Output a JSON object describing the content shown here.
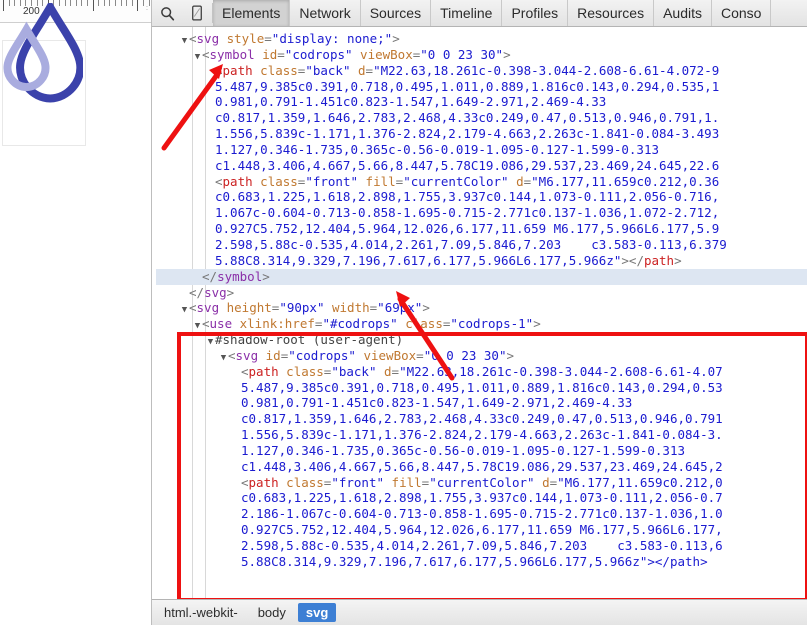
{
  "page_pane": {
    "ruler": {
      "label": "200",
      "name": "horizontal-ruler"
    },
    "logo": {
      "name": "codrops-water-droplet-logo",
      "back_color": "#a9acdf",
      "front_color": "#3b42ab"
    }
  },
  "devtools": {
    "toolbar": {
      "search_icon": "search-icon",
      "device_icon": "device-toggle-icon",
      "tabs": [
        {
          "label": "Elements",
          "selected": true
        },
        {
          "label": "Network",
          "selected": false
        },
        {
          "label": "Sources",
          "selected": false
        },
        {
          "label": "Timeline",
          "selected": false
        },
        {
          "label": "Profiles",
          "selected": false
        },
        {
          "label": "Resources",
          "selected": false
        },
        {
          "label": "Audits",
          "selected": false
        },
        {
          "label": "Conso",
          "selected": false
        }
      ]
    },
    "code_lines": [
      {
        "indent": 0,
        "twisty": "down",
        "segments": [
          {
            "t": "punc",
            "v": "<"
          },
          {
            "t": "tagp",
            "v": "svg"
          },
          {
            "t": "attr",
            "v": " style"
          },
          {
            "t": "punc",
            "v": "="
          },
          {
            "t": "val",
            "v": "\"display: none;\""
          },
          {
            "t": "punc",
            "v": ">"
          }
        ]
      },
      {
        "indent": 1,
        "twisty": "down",
        "segments": [
          {
            "t": "punc",
            "v": "<"
          },
          {
            "t": "tagp",
            "v": "symbol"
          },
          {
            "t": "attr",
            "v": " id"
          },
          {
            "t": "punc",
            "v": "="
          },
          {
            "t": "val",
            "v": "\"codrops\""
          },
          {
            "t": "attr",
            "v": " viewBox"
          },
          {
            "t": "punc",
            "v": "="
          },
          {
            "t": "val",
            "v": "\"0 0 23 30\""
          },
          {
            "t": "punc",
            "v": ">"
          }
        ]
      },
      {
        "indent": 2,
        "twisty": "none",
        "segments": [
          {
            "t": "punc",
            "v": "<"
          },
          {
            "t": "tagr",
            "v": "path"
          },
          {
            "t": "attr",
            "v": " class"
          },
          {
            "t": "punc",
            "v": "="
          },
          {
            "t": "val",
            "v": "\"back\""
          },
          {
            "t": "attr",
            "v": " d"
          },
          {
            "t": "punc",
            "v": "="
          },
          {
            "t": "val",
            "v": "\"M22.63,18.261c-0.398-3.044-2.608-6.61-4.072-9"
          }
        ]
      },
      {
        "indent": 2,
        "twisty": "none",
        "segments": [
          {
            "t": "val",
            "v": "5.487,9.385c0.391,0.718,0.495,1.011,0.889,1.816c0.143,0.294,0.535,1"
          }
        ]
      },
      {
        "indent": 2,
        "twisty": "none",
        "segments": [
          {
            "t": "val",
            "v": "0.981,0.791-1.451c0.823-1.547,1.649-2.971,2.469-4.33"
          }
        ]
      },
      {
        "indent": 2,
        "twisty": "none",
        "segments": [
          {
            "t": "val",
            "v": "c0.817,1.359,1.646,2.783,2.468,4.33c0.249,0.47,0.513,0.946,0.791,1."
          }
        ]
      },
      {
        "indent": 2,
        "twisty": "none",
        "segments": [
          {
            "t": "val",
            "v": "1.556,5.839c-1.171,1.376-2.824,2.179-4.663,2.263c-1.841-0.084-3.493"
          }
        ]
      },
      {
        "indent": 2,
        "twisty": "none",
        "segments": [
          {
            "t": "val",
            "v": "1.127,0.346-1.735,0.365c-0.56-0.019-1.095-0.127-1.599-0.313"
          }
        ]
      },
      {
        "indent": 2,
        "twisty": "none",
        "segments": [
          {
            "t": "val",
            "v": "c1.448,3.406,4.667,5.66,8.447,5.78C19.086,29.537,23.469,24.645,22.6"
          }
        ]
      },
      {
        "indent": 2,
        "twisty": "none",
        "segments": [
          {
            "t": "punc",
            "v": "<"
          },
          {
            "t": "tagr",
            "v": "path"
          },
          {
            "t": "attr",
            "v": " class"
          },
          {
            "t": "punc",
            "v": "="
          },
          {
            "t": "val",
            "v": "\"front\""
          },
          {
            "t": "attr",
            "v": " fill"
          },
          {
            "t": "punc",
            "v": "="
          },
          {
            "t": "val",
            "v": "\"currentColor\""
          },
          {
            "t": "attr",
            "v": " d"
          },
          {
            "t": "punc",
            "v": "="
          },
          {
            "t": "val",
            "v": "\"M6.177,11.659c0.212,0.36"
          }
        ]
      },
      {
        "indent": 2,
        "twisty": "none",
        "segments": [
          {
            "t": "val",
            "v": "c0.683,1.225,1.618,2.898,1.755,3.937c0.144,1.073-0.111,2.056-0.716,"
          }
        ]
      },
      {
        "indent": 2,
        "twisty": "none",
        "segments": [
          {
            "t": "val",
            "v": "1.067c-0.604-0.713-0.858-1.695-0.715-2.771c0.137-1.036,1.072-2.712,"
          }
        ]
      },
      {
        "indent": 2,
        "twisty": "none",
        "segments": [
          {
            "t": "val",
            "v": "0.927C5.752,12.404,5.964,12.026,6.177,11.659 M6.177,5.966L6.177,5.9"
          }
        ]
      },
      {
        "indent": 2,
        "twisty": "none",
        "segments": [
          {
            "t": "val",
            "v": "2.598,5.88c-0.535,4.014,2.261,7.09,5.846,7.203    c3.583-0.113,6.379"
          }
        ]
      },
      {
        "indent": 2,
        "twisty": "none",
        "segments": [
          {
            "t": "val",
            "v": "5.88C8.314,9.329,7.196,7.617,6.177,5.966L6.177,5.966z\""
          },
          {
            "t": "punc",
            "v": ">"
          },
          {
            "t": "punc",
            "v": "</"
          },
          {
            "t": "tagr",
            "v": "path"
          },
          {
            "t": "punc",
            "v": ">"
          }
        ]
      },
      {
        "indent": 1,
        "twisty": "none",
        "highlight": true,
        "segments": [
          {
            "t": "punc",
            "v": "</"
          },
          {
            "t": "tagp",
            "v": "symbol"
          },
          {
            "t": "punc",
            "v": ">"
          }
        ]
      },
      {
        "indent": 0,
        "twisty": "none",
        "segments": [
          {
            "t": "punc",
            "v": "</"
          },
          {
            "t": "tagp",
            "v": "svg"
          },
          {
            "t": "punc",
            "v": ">"
          }
        ]
      },
      {
        "indent": 0,
        "twisty": "down",
        "segments": [
          {
            "t": "punc",
            "v": "<"
          },
          {
            "t": "tagp",
            "v": "svg"
          },
          {
            "t": "attr",
            "v": " height"
          },
          {
            "t": "punc",
            "v": "="
          },
          {
            "t": "val",
            "v": "\"90px\""
          },
          {
            "t": "attr",
            "v": " width"
          },
          {
            "t": "punc",
            "v": "="
          },
          {
            "t": "val",
            "v": "\"69px\""
          },
          {
            "t": "punc",
            "v": ">"
          }
        ]
      },
      {
        "indent": 1,
        "twisty": "down",
        "segments": [
          {
            "t": "punc",
            "v": "<"
          },
          {
            "t": "tagp",
            "v": "use"
          },
          {
            "t": "attr",
            "v": " xlink:href"
          },
          {
            "t": "punc",
            "v": "="
          },
          {
            "t": "val",
            "v": "\"#codrops\""
          },
          {
            "t": "attr",
            "v": " class"
          },
          {
            "t": "punc",
            "v": "="
          },
          {
            "t": "val",
            "v": "\"codrops-1\""
          },
          {
            "t": "punc",
            "v": ">"
          }
        ]
      },
      {
        "indent": 2,
        "twisty": "down",
        "segments": [
          {
            "t": "shadow",
            "v": "#shadow-root (user-agent)"
          }
        ]
      },
      {
        "indent": 3,
        "twisty": "down",
        "segments": [
          {
            "t": "punc",
            "v": "<"
          },
          {
            "t": "tagp",
            "v": "svg"
          },
          {
            "t": "attr",
            "v": " id"
          },
          {
            "t": "punc",
            "v": "="
          },
          {
            "t": "val",
            "v": "\"codrops\""
          },
          {
            "t": "attr",
            "v": " viewBox"
          },
          {
            "t": "punc",
            "v": "="
          },
          {
            "t": "val",
            "v": "\"0 0 23 30\""
          },
          {
            "t": "punc",
            "v": ">"
          }
        ]
      },
      {
        "indent": 4,
        "twisty": "none",
        "segments": [
          {
            "t": "punc",
            "v": "<"
          },
          {
            "t": "tagr",
            "v": "path"
          },
          {
            "t": "attr",
            "v": " class"
          },
          {
            "t": "punc",
            "v": "="
          },
          {
            "t": "val",
            "v": "\"back\""
          },
          {
            "t": "attr",
            "v": " d"
          },
          {
            "t": "punc",
            "v": "="
          },
          {
            "t": "val",
            "v": "\"M22.63,18.261c-0.398-3.044-2.608-6.61-4.07"
          }
        ]
      },
      {
        "indent": 4,
        "twisty": "none",
        "segments": [
          {
            "t": "val",
            "v": "5.487,9.385c0.391,0.718,0.495,1.011,0.889,1.816c0.143,0.294,0.53"
          }
        ]
      },
      {
        "indent": 4,
        "twisty": "none",
        "segments": [
          {
            "t": "val",
            "v": "0.981,0.791-1.451c0.823-1.547,1.649-2.971,2.469-4.33"
          }
        ]
      },
      {
        "indent": 4,
        "twisty": "none",
        "segments": [
          {
            "t": "val",
            "v": "c0.817,1.359,1.646,2.783,2.468,4.33c0.249,0.47,0.513,0.946,0.791"
          }
        ]
      },
      {
        "indent": 4,
        "twisty": "none",
        "segments": [
          {
            "t": "val",
            "v": "1.556,5.839c-1.171,1.376-2.824,2.179-4.663,2.263c-1.841-0.084-3."
          }
        ]
      },
      {
        "indent": 4,
        "twisty": "none",
        "segments": [
          {
            "t": "val",
            "v": "1.127,0.346-1.735,0.365c-0.56-0.019-1.095-0.127-1.599-0.313"
          }
        ]
      },
      {
        "indent": 4,
        "twisty": "none",
        "segments": [
          {
            "t": "val",
            "v": "c1.448,3.406,4.667,5.66,8.447,5.78C19.086,29.537,23.469,24.645,2"
          }
        ]
      },
      {
        "indent": 4,
        "twisty": "none",
        "segments": [
          {
            "t": "punc",
            "v": "<"
          },
          {
            "t": "tagr",
            "v": "path"
          },
          {
            "t": "attr",
            "v": " class"
          },
          {
            "t": "punc",
            "v": "="
          },
          {
            "t": "val",
            "v": "\"front\""
          },
          {
            "t": "attr",
            "v": " fill"
          },
          {
            "t": "punc",
            "v": "="
          },
          {
            "t": "val",
            "v": "\"currentColor\""
          },
          {
            "t": "attr",
            "v": " d"
          },
          {
            "t": "punc",
            "v": "="
          },
          {
            "t": "val",
            "v": "\"M6.177,11.659c0.212,0"
          }
        ]
      },
      {
        "indent": 4,
        "twisty": "none",
        "segments": [
          {
            "t": "val",
            "v": "c0.683,1.225,1.618,2.898,1.755,3.937c0.144,1.073-0.111,2.056-0.7"
          }
        ]
      },
      {
        "indent": 4,
        "twisty": "none",
        "segments": [
          {
            "t": "val",
            "v": "2.186-1.067c-0.604-0.713-0.858-1.695-0.715-2.771c0.137-1.036,1.0"
          }
        ]
      },
      {
        "indent": 4,
        "twisty": "none",
        "segments": [
          {
            "t": "val",
            "v": "0.927C5.752,12.404,5.964,12.026,6.177,11.659 M6.177,5.966L6.177,"
          }
        ]
      },
      {
        "indent": 4,
        "twisty": "none",
        "segments": [
          {
            "t": "val",
            "v": "2.598,5.88c-0.535,4.014,2.261,7.09,5.846,7.203    c3.583-0.113,6"
          }
        ]
      },
      {
        "indent": 4,
        "twisty": "none",
        "segments": [
          {
            "t": "val",
            "v": "5.88C8.314,9.329,7.196,7.617,6.177,5.966L6.177,5.966z\"></path>"
          }
        ]
      }
    ],
    "breadcrumb": [
      {
        "label": "html.-webkit-",
        "active": false
      },
      {
        "label": "body",
        "active": false
      },
      {
        "label": "svg",
        "active": true
      }
    ],
    "annotations": {
      "highlight_color": "#ee1111",
      "arrow_1_target": "symbol-tag",
      "arrow_2_target": "use-tag",
      "rect_target": "shadow-root-block"
    }
  }
}
